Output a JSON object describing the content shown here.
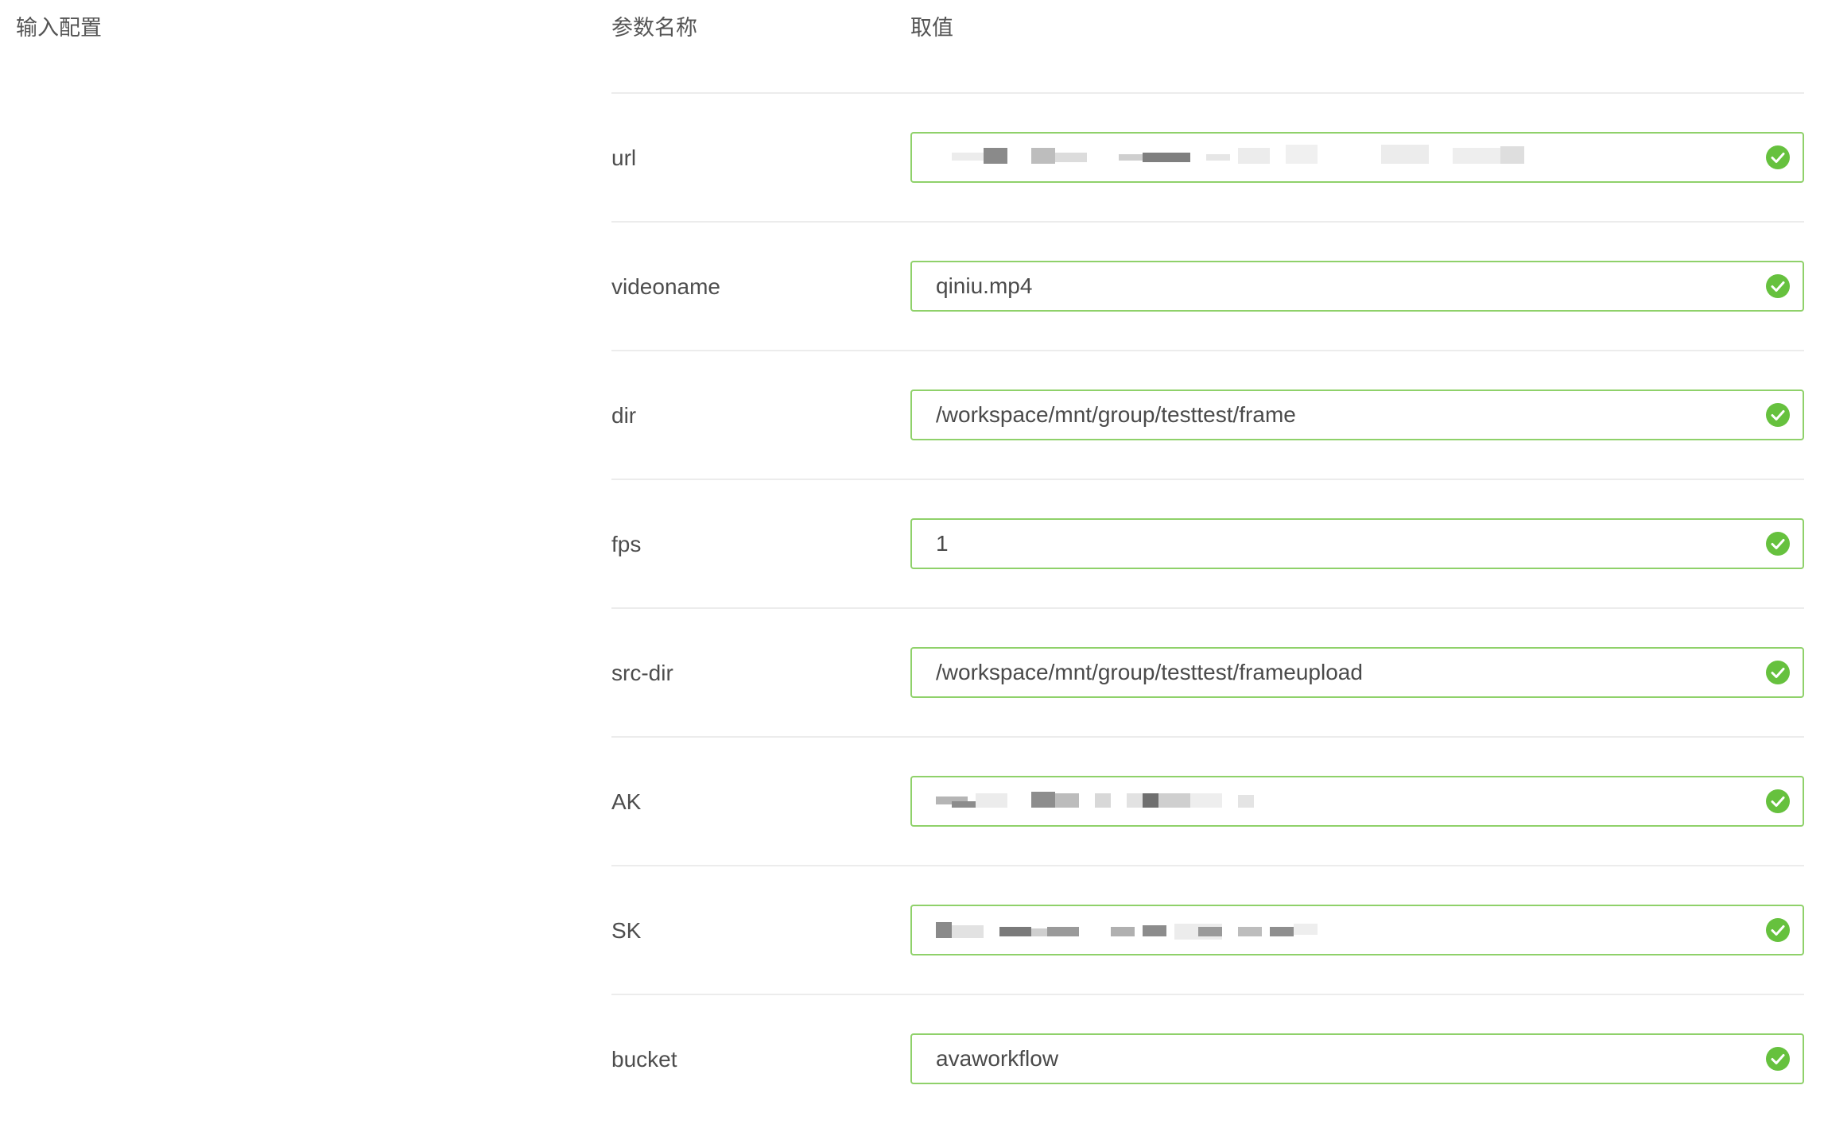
{
  "section": {
    "title": "输入配置"
  },
  "table": {
    "headers": {
      "name": "参数名称",
      "value": "取值"
    },
    "rows": [
      {
        "name": "url",
        "value": "",
        "redacted": true,
        "status": "check-circle-icon"
      },
      {
        "name": "videoname",
        "value": "qiniu.mp4",
        "redacted": false,
        "status": "check-circle-icon"
      },
      {
        "name": "dir",
        "value": "/workspace/mnt/group/testtest/frame",
        "redacted": false,
        "status": "check-circle-icon"
      },
      {
        "name": "fps",
        "value": "1",
        "redacted": false,
        "status": "check-circle-icon"
      },
      {
        "name": "src-dir",
        "value": "/workspace/mnt/group/testtest/frameupload",
        "redacted": false,
        "status": "check-circle-icon"
      },
      {
        "name": "AK",
        "value": "",
        "redacted": true,
        "status": "check-circle-icon"
      },
      {
        "name": "SK",
        "value": "",
        "redacted": true,
        "status": "check-circle-icon"
      },
      {
        "name": "bucket",
        "value": "avaworkflow",
        "redacted": false,
        "status": "check-circle-icon"
      }
    ]
  },
  "colors": {
    "field_border": "#8fd16a",
    "check_fill": "#66c13e",
    "divider": "#ececec",
    "text": "#4a4a4a"
  }
}
